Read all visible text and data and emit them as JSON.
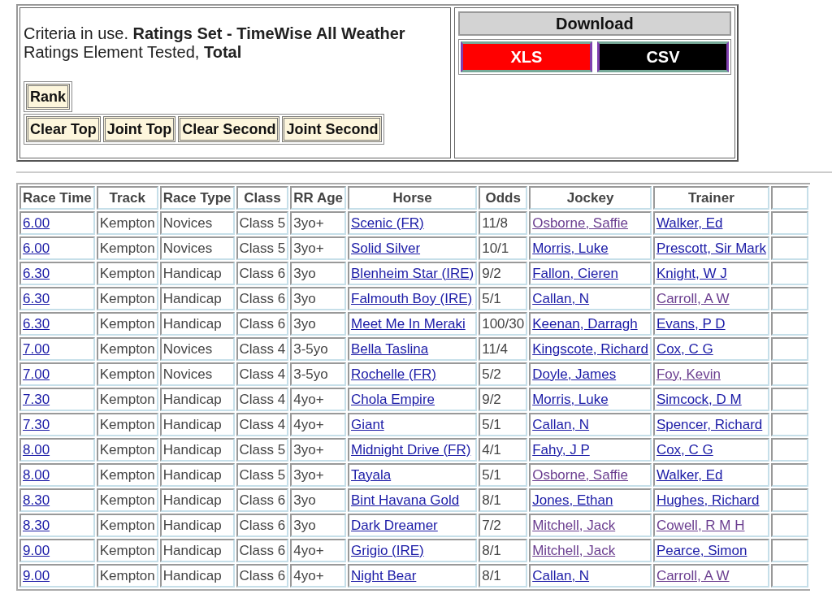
{
  "criteria": {
    "ratings_set": "Criteria in use. **Ratings Set - TimeWise All Weather**",
    "element": "Ratings Element Tested, **Total**"
  },
  "rank_button": "Rank",
  "filter_buttons": [
    "Clear Top",
    "Joint Top",
    "Clear Second",
    "Joint Second"
  ],
  "download": {
    "title": "Download",
    "buttons": [
      {
        "label": "XLS",
        "kind": "xls"
      },
      {
        "label": "CSV",
        "kind": "csv"
      }
    ]
  },
  "table": {
    "columns": [
      "Race Time",
      "Track",
      "Race Type",
      "Class",
      "RR Age",
      "Horse",
      "Odds",
      "Jockey",
      "Trainer"
    ],
    "rows": [
      {
        "race_time": "6.00",
        "track": "Kempton",
        "race_type": "Novices",
        "class": "Class 5",
        "rr_age": "3yo+",
        "horse": "Scenic (FR)",
        "odds": "11/8",
        "jockey": {
          "name": "Osborne, Saffie",
          "visited": true
        },
        "trainer": {
          "name": "Walker, Ed",
          "visited": false
        }
      },
      {
        "race_time": "6.00",
        "track": "Kempton",
        "race_type": "Novices",
        "class": "Class 5",
        "rr_age": "3yo+",
        "horse": "Solid Silver",
        "odds": "10/1",
        "jockey": {
          "name": "Morris, Luke",
          "visited": false
        },
        "trainer": {
          "name": "Prescott, Sir Mark",
          "visited": false
        }
      },
      {
        "race_time": "6.30",
        "track": "Kempton",
        "race_type": "Handicap",
        "class": "Class 6",
        "rr_age": "3yo",
        "horse": "Blenheim Star (IRE)",
        "odds": "9/2",
        "jockey": {
          "name": "Fallon, Cieren",
          "visited": false
        },
        "trainer": {
          "name": "Knight, W J",
          "visited": false
        }
      },
      {
        "race_time": "6.30",
        "track": "Kempton",
        "race_type": "Handicap",
        "class": "Class 6",
        "rr_age": "3yo",
        "horse": "Falmouth Boy (IRE)",
        "odds": "5/1",
        "jockey": {
          "name": "Callan, N",
          "visited": false
        },
        "trainer": {
          "name": "Carroll, A W",
          "visited": true
        }
      },
      {
        "race_time": "6.30",
        "track": "Kempton",
        "race_type": "Handicap",
        "class": "Class 6",
        "rr_age": "3yo",
        "horse": "Meet Me In Meraki",
        "odds": "100/30",
        "jockey": {
          "name": "Keenan, Darragh",
          "visited": false
        },
        "trainer": {
          "name": "Evans, P D",
          "visited": false
        }
      },
      {
        "race_time": "7.00",
        "track": "Kempton",
        "race_type": "Novices",
        "class": "Class 4",
        "rr_age": "3-5yo",
        "horse": "Bella Taslina",
        "odds": "11/4",
        "jockey": {
          "name": "Kingscote, Richard",
          "visited": false
        },
        "trainer": {
          "name": "Cox, C G",
          "visited": false
        }
      },
      {
        "race_time": "7.00",
        "track": "Kempton",
        "race_type": "Novices",
        "class": "Class 4",
        "rr_age": "3-5yo",
        "horse": "Rochelle (FR)",
        "odds": "5/2",
        "jockey": {
          "name": "Doyle, James",
          "visited": false
        },
        "trainer": {
          "name": "Foy, Kevin",
          "visited": true
        }
      },
      {
        "race_time": "7.30",
        "track": "Kempton",
        "race_type": "Handicap",
        "class": "Class 4",
        "rr_age": "4yo+",
        "horse": "Chola Empire",
        "odds": "9/2",
        "jockey": {
          "name": "Morris, Luke",
          "visited": false
        },
        "trainer": {
          "name": "Simcock, D M",
          "visited": false
        }
      },
      {
        "race_time": "7.30",
        "track": "Kempton",
        "race_type": "Handicap",
        "class": "Class 4",
        "rr_age": "4yo+",
        "horse": "Giant",
        "odds": "5/1",
        "jockey": {
          "name": "Callan, N",
          "visited": false
        },
        "trainer": {
          "name": "Spencer, Richard",
          "visited": false
        }
      },
      {
        "race_time": "8.00",
        "track": "Kempton",
        "race_type": "Handicap",
        "class": "Class 5",
        "rr_age": "3yo+",
        "horse": "Midnight Drive (FR)",
        "odds": "4/1",
        "jockey": {
          "name": "Fahy, J P",
          "visited": false
        },
        "trainer": {
          "name": "Cox, C G",
          "visited": false
        }
      },
      {
        "race_time": "8.00",
        "track": "Kempton",
        "race_type": "Handicap",
        "class": "Class 5",
        "rr_age": "3yo+",
        "horse": "Tayala",
        "odds": "5/1",
        "jockey": {
          "name": "Osborne, Saffie",
          "visited": true
        },
        "trainer": {
          "name": "Walker, Ed",
          "visited": false
        }
      },
      {
        "race_time": "8.30",
        "track": "Kempton",
        "race_type": "Handicap",
        "class": "Class 6",
        "rr_age": "3yo",
        "horse": "Bint Havana Gold",
        "odds": "8/1",
        "jockey": {
          "name": "Jones, Ethan",
          "visited": false
        },
        "trainer": {
          "name": "Hughes, Richard",
          "visited": false
        }
      },
      {
        "race_time": "8.30",
        "track": "Kempton",
        "race_type": "Handicap",
        "class": "Class 6",
        "rr_age": "3yo",
        "horse": "Dark Dreamer",
        "odds": "7/2",
        "jockey": {
          "name": "Mitchell, Jack",
          "visited": true
        },
        "trainer": {
          "name": "Cowell, R M H",
          "visited": true
        }
      },
      {
        "race_time": "9.00",
        "track": "Kempton",
        "race_type": "Handicap",
        "class": "Class 6",
        "rr_age": "4yo+",
        "horse": "Grigio (IRE)",
        "odds": "8/1",
        "jockey": {
          "name": "Mitchell, Jack",
          "visited": true
        },
        "trainer": {
          "name": "Pearce, Simon",
          "visited": false
        }
      },
      {
        "race_time": "9.00",
        "track": "Kempton",
        "race_type": "Handicap",
        "class": "Class 6",
        "rr_age": "4yo+",
        "horse": "Night Bear",
        "odds": "8/1",
        "jockey": {
          "name": "Callan, N",
          "visited": false
        },
        "trainer": {
          "name": "Carroll, A W",
          "visited": true
        }
      }
    ]
  }
}
